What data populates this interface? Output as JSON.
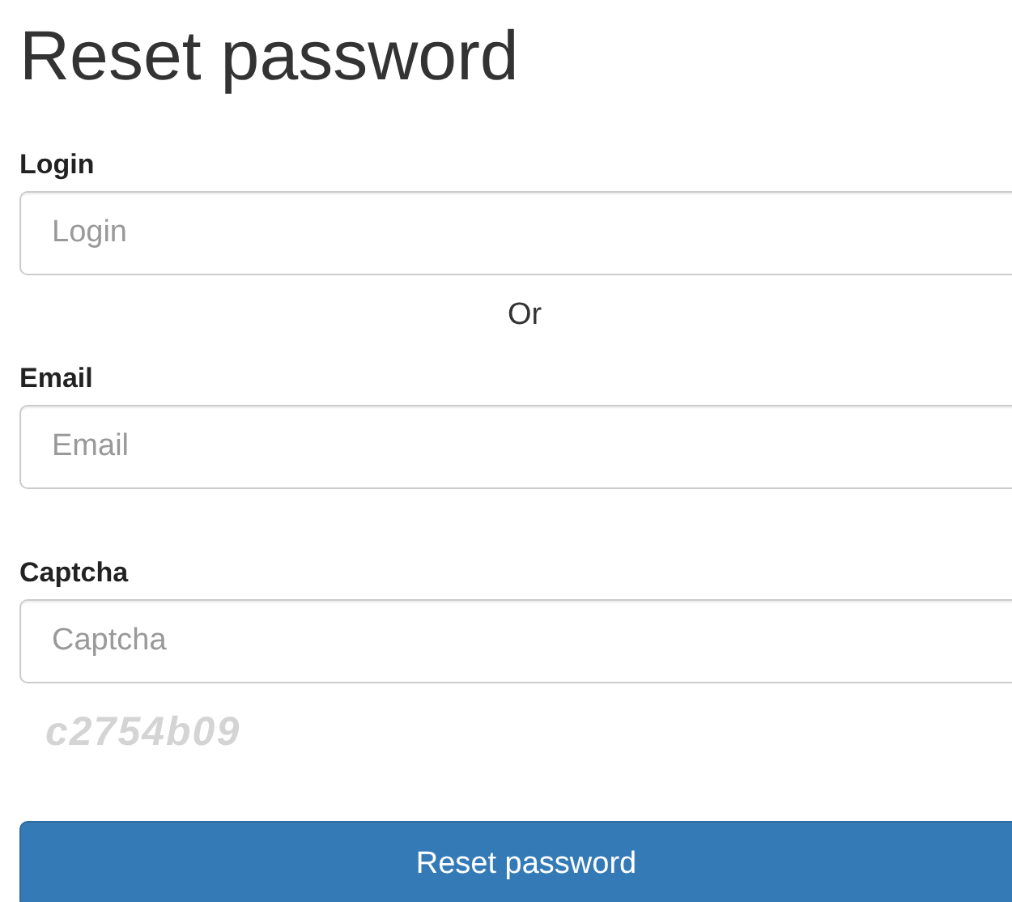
{
  "title": "Reset password",
  "login": {
    "label": "Login",
    "placeholder": "Login"
  },
  "separator": "Or",
  "email": {
    "label": "Email",
    "placeholder": "Email"
  },
  "captcha": {
    "label": "Captcha",
    "placeholder": "Captcha",
    "code": "c2754b09"
  },
  "submit": "Reset password"
}
